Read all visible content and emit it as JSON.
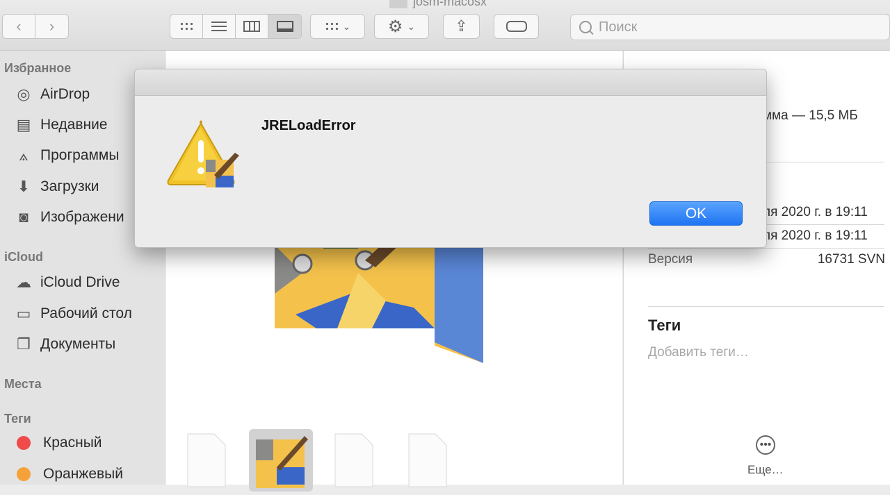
{
  "window": {
    "title": "josm-macosx"
  },
  "toolbar": {
    "search_placeholder": "Поиск",
    "nav_back_icon": "chevron-left-icon",
    "nav_forward_icon": "chevron-right-icon"
  },
  "sidebar": {
    "favorites_header": "Избранное",
    "favorites": [
      {
        "label": "AirDrop",
        "icon": "airdrop-icon"
      },
      {
        "label": "Недавние",
        "icon": "recents-icon"
      },
      {
        "label": "Программы",
        "icon": "applications-icon"
      },
      {
        "label": "Загрузки",
        "icon": "downloads-icon"
      },
      {
        "label": "Изображени",
        "icon": "pictures-icon"
      }
    ],
    "icloud_header": "iCloud",
    "icloud": [
      {
        "label": "iCloud Drive",
        "icon": "cloud-icon"
      },
      {
        "label": "Рабочий стол",
        "icon": "desktop-icon"
      },
      {
        "label": "Документы",
        "icon": "documents-icon"
      }
    ],
    "places_header": "Места",
    "tags_header": "Теги",
    "tags": [
      {
        "label": "Красный",
        "color": "#f04a4a"
      },
      {
        "label": "Оранжевый",
        "color": "#f5a23a"
      }
    ]
  },
  "info": {
    "kind_fragment": "мма — 15,5 МБ",
    "created_fragment": "ля 2020 г. в 19:11",
    "modified_fragment": "ля 2020 г. в 19:11",
    "version_label": "Версия",
    "version_value": "16731 SVN",
    "tags_header": "Теги",
    "tags_placeholder": "Добавить теги…",
    "more_label": "Еще…"
  },
  "dialog": {
    "title": "JRELoadError",
    "ok_label": "OK",
    "accent": "#1f74f2"
  }
}
